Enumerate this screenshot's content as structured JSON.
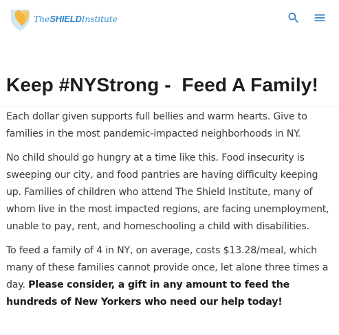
{
  "header": {
    "logo_text_prefix": "The",
    "logo_text_bold": "SHIELD",
    "logo_text_suffix": "Institute",
    "search_icon": "search-icon",
    "menu_icon": "menu-icon"
  },
  "colors": {
    "heart_orange": "#f5b53a",
    "shield_blue": "#3a93cf",
    "text_dark": "#1c1c1c",
    "text_body": "#3a3a3a",
    "icon_blue": "#2f7cc4"
  },
  "main": {
    "title": "Keep #NYStrong -  Feed A Family!",
    "paragraphs": [
      "Each dollar given supports full bellies and warm hearts. Give to families in the most pandemic-impacted neighborhoods in NY.",
      "No child should go hungry at a time like this. Food insecurity is sweeping our city, and food pantries are having difficulty keeping up. Families of children who attend The Shield Institute, many of whom live in the most impacted regions, are facing unemployment, unable to pay, rent, and homeschooling a child with disabilities."
    ],
    "last_paragraph_plain": "To feed a family of 4 in NY, on average, costs $13.28/meal, which many of these families cannot provide once, let alone three times a day. ",
    "last_paragraph_bold": "Please consider, a gift in any amount to feed the hundreds of New Yorkers who need our help today!"
  }
}
